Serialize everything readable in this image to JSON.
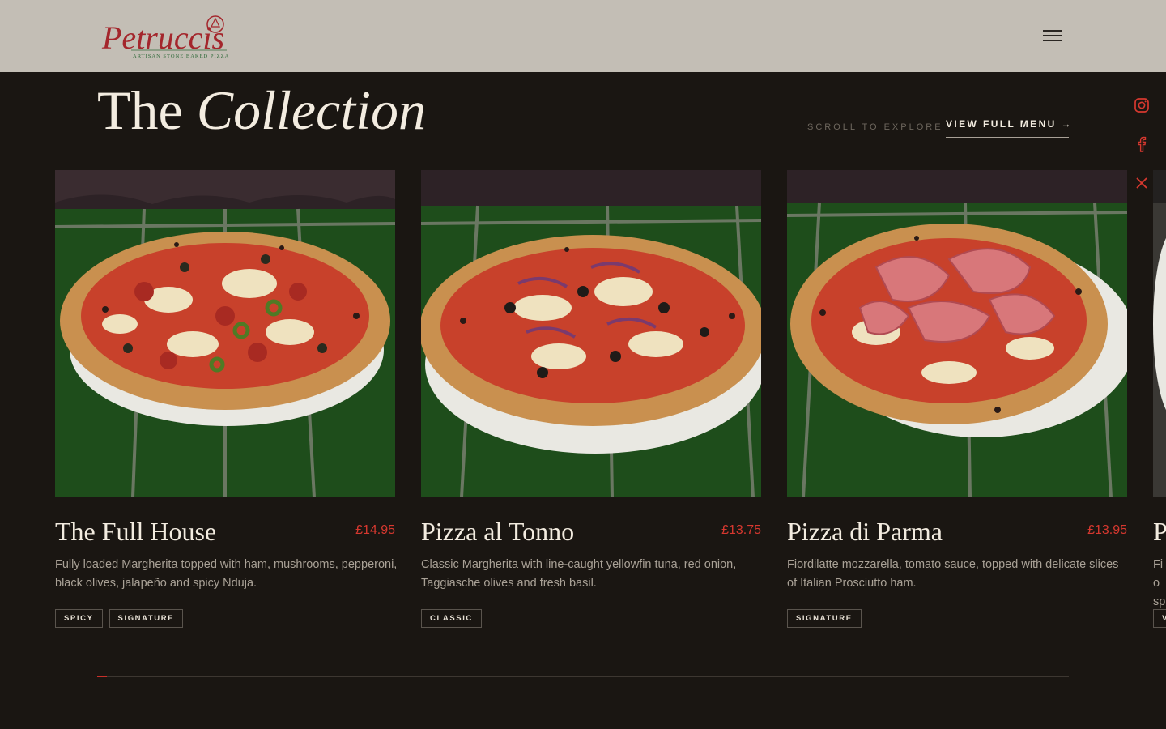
{
  "header": {
    "logo_text": "Petruccis",
    "logo_tagline": "ARTISAN STONE BAKED PIZZA"
  },
  "section": {
    "title_plain": "The",
    "title_italic": "Collection",
    "scroll_hint": "SCROLL TO EXPLORE",
    "view_full_menu": "VIEW FULL MENU →"
  },
  "social": [
    "instagram-icon",
    "facebook-icon",
    "x-icon"
  ],
  "colors": {
    "accent": "#d6382f",
    "background": "#1a1612",
    "header": "#c3beb5"
  },
  "cards": [
    {
      "name": "The Full House",
      "price": "£14.95",
      "description": "Fully loaded Margherita topped with ham, mushrooms, pepperoni, black olives, jalapeño and spicy Nduja.",
      "tags": [
        "SPICY",
        "SIGNATURE"
      ]
    },
    {
      "name": "Pizza al Tonno",
      "price": "£13.75",
      "description": "Classic Margherita with line-caught yellowfin tuna, red onion, Taggiasche olives and fresh basil.",
      "tags": [
        "CLASSIC"
      ]
    },
    {
      "name": "Pizza di Parma",
      "price": "£13.95",
      "description": "Fiordilatte mozzarella, tomato sauce, topped with delicate slices of Italian Prosciutto ham.",
      "tags": [
        "SIGNATURE"
      ]
    },
    {
      "name": "P",
      "price": "",
      "description": "Fio sp",
      "tags": [
        "V"
      ]
    }
  ],
  "carousel": {
    "progress": 0.01
  }
}
